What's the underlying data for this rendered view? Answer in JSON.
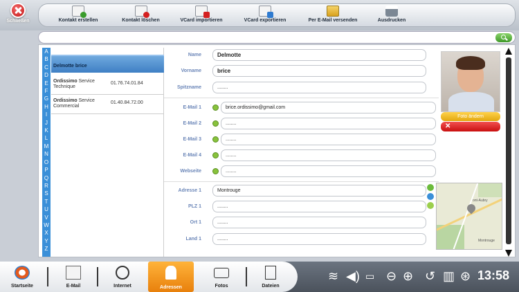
{
  "close_label": "Schließen",
  "toolbar": {
    "create": "Kontakt erstellen",
    "delete": "Kontakt löschen",
    "import": "VCard importieren",
    "export": "VCard exportieren",
    "email": "Per E-Mail versenden",
    "print": "Ausdrucken"
  },
  "search": {
    "value": ""
  },
  "alphabet": [
    "A",
    "B",
    "C",
    "D",
    "E",
    "F",
    "G",
    "H",
    "I",
    "J",
    "K",
    "L",
    "M",
    "N",
    "O",
    "P",
    "Q",
    "R",
    "S",
    "T",
    "U",
    "V",
    "W",
    "X",
    "Y",
    "Z"
  ],
  "contacts": {
    "selected": "Delmotte brice",
    "rows": [
      {
        "name": "Ordissimo",
        "sub": "Service Technique",
        "phone": "01.76.74.01.84"
      },
      {
        "name": "Ordissimo",
        "sub": "Service Commercial",
        "phone": "01.40.84.72.00"
      }
    ]
  },
  "form": {
    "name_label": "Name",
    "name": "Delmotte",
    "vorname_label": "Vorname",
    "vorname": "brice",
    "spitzname_label": "Spitzname",
    "spitzname": "........",
    "email1_label": "E-Mail 1",
    "email1": "brice.ordissimo@gmail.com",
    "email2_label": "E-Mail 2",
    "email2": "........",
    "email3_label": "E-Mail 3",
    "email3": "........",
    "email4_label": "E-Mail 4",
    "email4": "........",
    "web_label": "Webseite",
    "web": "........",
    "adresse1_label": "Adresse 1",
    "adresse1": "Montrouge",
    "plz1_label": "PLZ 1",
    "plz1": "........",
    "ort1_label": "Ort 1",
    "ort1": "........",
    "land1_label": "Land 1",
    "land1": "........"
  },
  "photo_button": "Foto ändern",
  "map_labels": {
    "a": "ont-Aubry",
    "b": "Montrouge"
  },
  "dock": {
    "home": "Startseite",
    "email": "E-Mail",
    "internet": "Internet",
    "addresses": "Adressen",
    "photos": "Fotos",
    "files": "Dateien"
  },
  "clock": "13:58",
  "colors": {
    "accent_orange": "#f09a1f",
    "alpha_blue": "#3a8fd8",
    "selection_blue": "#4f8fd0"
  }
}
